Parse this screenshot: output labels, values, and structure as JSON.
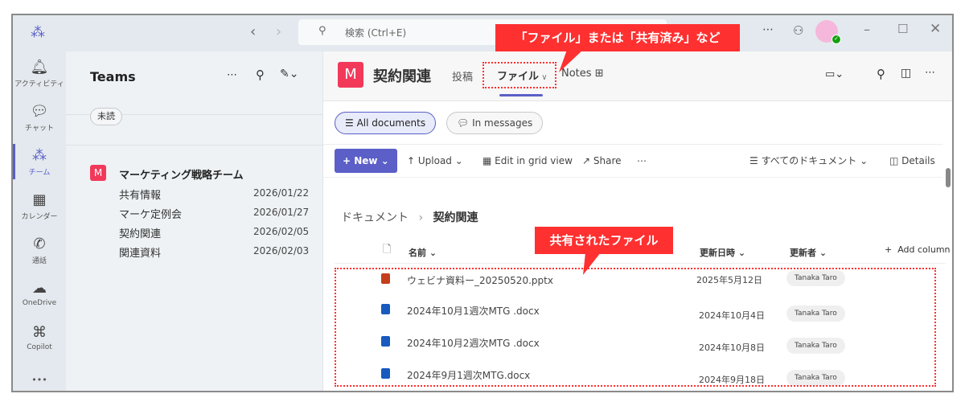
{
  "titlebar": {
    "search_placeholder": "検索 (Ctrl+E)",
    "more": "⋯"
  },
  "rail": [
    {
      "label": "アクティビティ",
      "icon": "bell-icon"
    },
    {
      "label": "チャット",
      "icon": "chat-icon"
    },
    {
      "label": "チーム",
      "icon": "teams-icon"
    },
    {
      "label": "カレンダー",
      "icon": "calendar-icon"
    },
    {
      "label": "通話",
      "icon": "phone-icon"
    },
    {
      "label": "OneDrive",
      "icon": "cloud-icon"
    },
    {
      "label": "Copilot",
      "icon": "copilot-icon"
    }
  ],
  "rail_more": "•••",
  "teams_panel": {
    "title": "Teams",
    "filter": "未読",
    "team": {
      "initial": "M",
      "name": "マーケティング戦略チーム",
      "channels": [
        {
          "name": "共有情報",
          "date": "2026/01/22"
        },
        {
          "name": "マーケ定例会",
          "date": "2026/01/27"
        },
        {
          "name": "契約関連",
          "date": "2026/02/05"
        },
        {
          "name": "関連資料",
          "date": "2026/02/03"
        }
      ]
    }
  },
  "channel": {
    "initial": "M",
    "title": "契約関連",
    "tabs": [
      "投稿",
      "ファイル",
      "Notes"
    ]
  },
  "views": {
    "all": "All documents",
    "messages": "In messages"
  },
  "toolbar": {
    "new": "New",
    "upload": "Upload",
    "grid": "Edit in grid view",
    "share": "Share",
    "more": "⋯",
    "view": "すべてのドキュメント",
    "details": "Details"
  },
  "breadcrumb": {
    "root": "ドキュメント",
    "current": "契約関連"
  },
  "columns": {
    "name": "名前",
    "modified": "更新日時",
    "modified_by": "更新者",
    "add": "Add column"
  },
  "files": [
    {
      "name": "ウェビナ資料ー_20250520.pptx",
      "type": "pptx",
      "date": "2025年5月12日",
      "by": "Tanaka Taro"
    },
    {
      "name": "2024年10月1週次MTG .docx",
      "type": "docx",
      "date": "2024年10月4日",
      "by": "Tanaka Taro"
    },
    {
      "name": "2024年10月2週次MTG .docx",
      "type": "docx",
      "date": "2024年10月8日",
      "by": "Tanaka Taro"
    },
    {
      "name": "2024年9月1週次MTG.docx",
      "type": "docx",
      "date": "2024年9月18日",
      "by": "Tanaka Taro"
    }
  ],
  "annotations": {
    "tab_note": "「ファイル」または「共有済み」など",
    "files_note": "共有されたファイル"
  },
  "colors": {
    "accent": "#5b5fc7",
    "team": "#f2395a",
    "callout": "#ff3030"
  }
}
